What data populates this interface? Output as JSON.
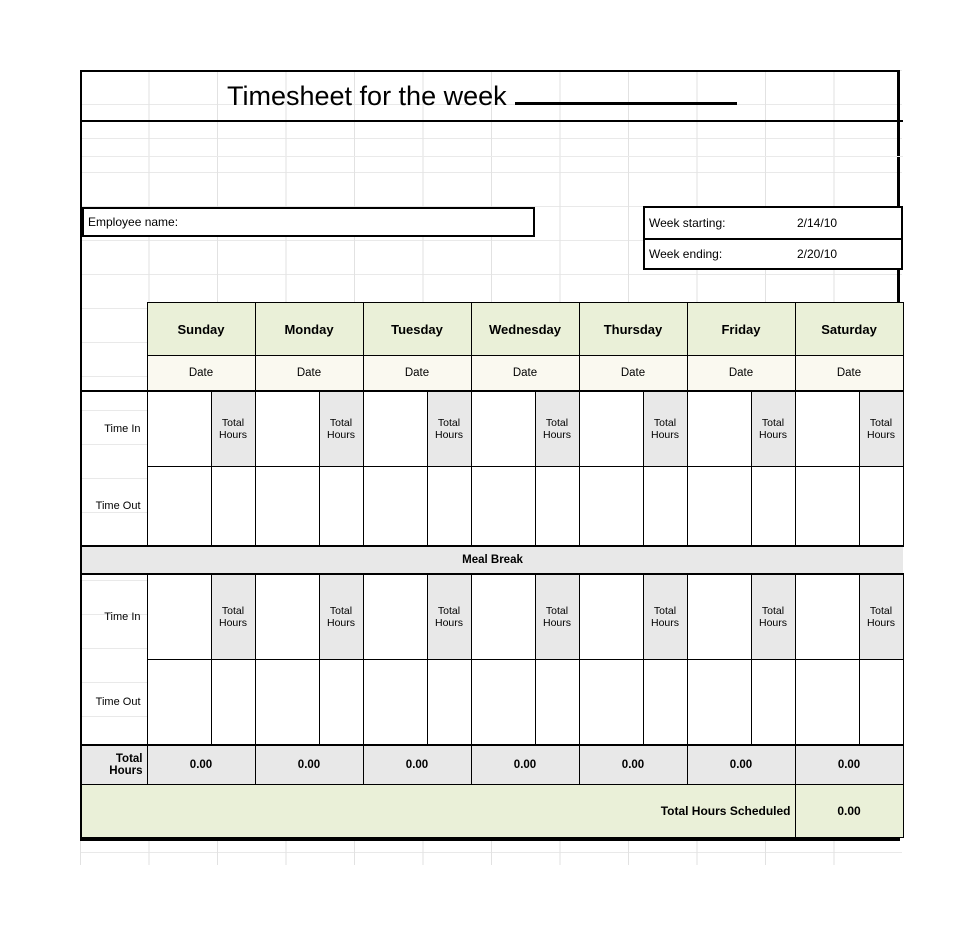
{
  "document": {
    "title_text": "Timesheet for the week",
    "title_blank": ""
  },
  "info": {
    "employee_label": "Employee name:",
    "employee_value": "",
    "week_starting_label": "Week starting:",
    "week_starting_value": "2/14/10",
    "week_ending_label": "Week ending:",
    "week_ending_value": "2/20/10"
  },
  "days": [
    {
      "name": "Sunday",
      "date_label": "Date",
      "date_value": "",
      "total": "0.00"
    },
    {
      "name": "Monday",
      "date_label": "Date",
      "date_value": "",
      "total": "0.00"
    },
    {
      "name": "Tuesday",
      "date_label": "Date",
      "date_value": "",
      "total": "0.00"
    },
    {
      "name": "Wednesday",
      "date_label": "Date",
      "date_value": "",
      "total": "0.00"
    },
    {
      "name": "Thursday",
      "date_label": "Date",
      "date_value": "",
      "total": "0.00"
    },
    {
      "name": "Friday",
      "date_label": "Date",
      "date_value": "",
      "total": "0.00"
    },
    {
      "name": "Saturday",
      "date_label": "Date",
      "date_value": "",
      "total": "0.00"
    }
  ],
  "rows": {
    "time_in_label": "Time In",
    "time_out_label": "Time Out",
    "total_hours_cell_label": "Total Hours",
    "meal_break_label": "Meal Break",
    "total_hours_label": "Total Hours",
    "total_hours_scheduled_label": "Total Hours Scheduled",
    "total_hours_scheduled_value": "0.00"
  },
  "colors": {
    "header_green": "#eaf0d8",
    "date_cream": "#faf9f0",
    "gray_band": "#e8e8e8",
    "border_black": "#000000"
  }
}
